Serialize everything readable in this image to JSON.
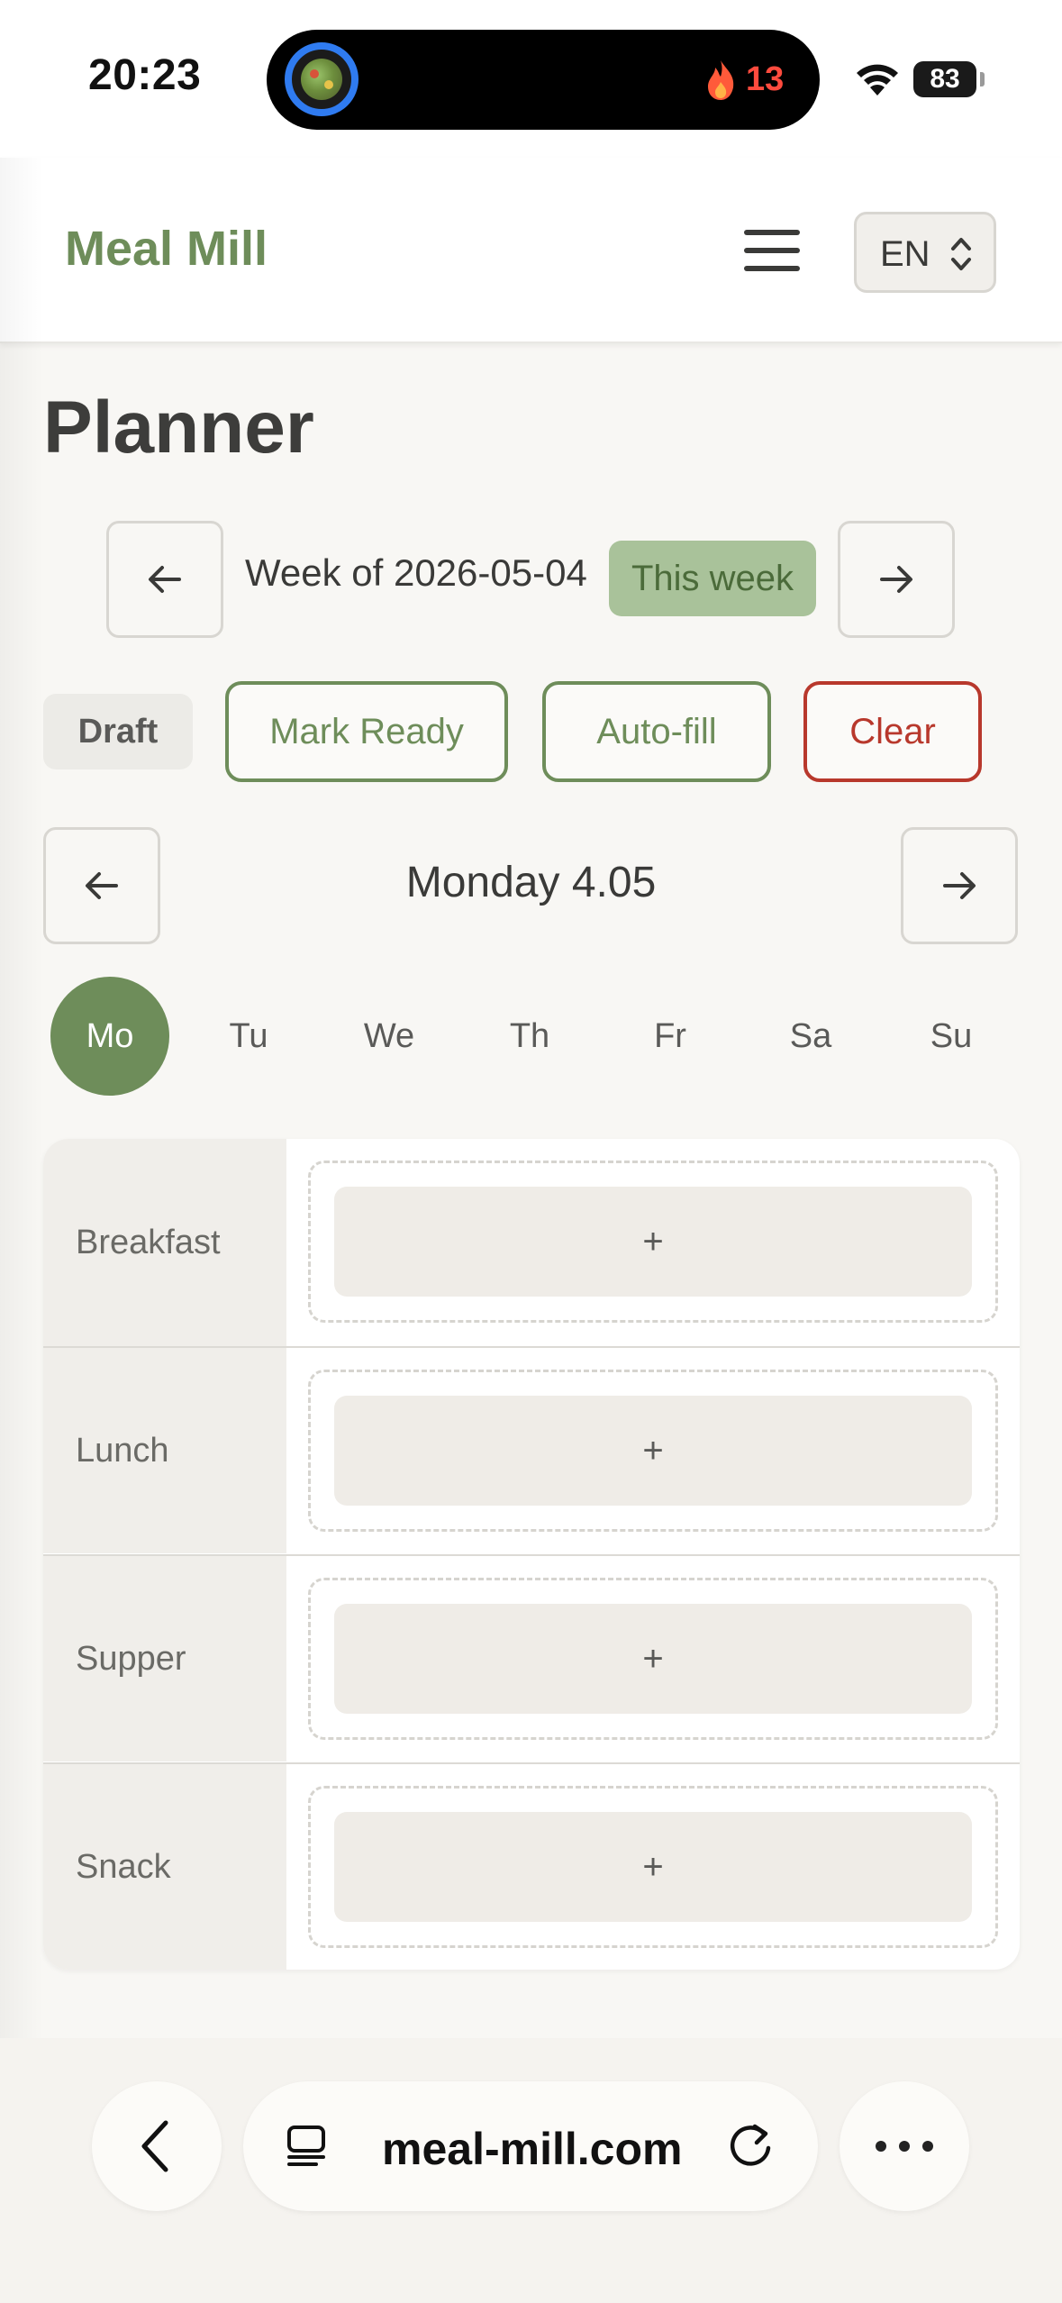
{
  "status_bar": {
    "time": "20:23",
    "streak_count": "13",
    "battery": "83",
    "icons": [
      "activity-ring-icon",
      "flame-icon",
      "wifi-icon",
      "battery-icon"
    ]
  },
  "header": {
    "brand": "Meal Mill",
    "menu_icon": "hamburger-icon",
    "language": "EN"
  },
  "planner": {
    "title": "Planner",
    "week_label": "Week of 2026-05-04",
    "this_week_label": "This week",
    "prev_week_icon": "arrow-left-icon",
    "next_week_icon": "arrow-right-icon",
    "status_badge": "Draft",
    "actions": {
      "mark_ready": "Mark Ready",
      "auto_fill": "Auto-fill",
      "clear": "Clear"
    },
    "day_title": "Monday 4.05",
    "days": [
      "Mo",
      "Tu",
      "We",
      "Th",
      "Fr",
      "Sa",
      "Su"
    ],
    "active_day": "Mo",
    "meals": [
      {
        "label": "Breakfast",
        "add": "+"
      },
      {
        "label": "Lunch",
        "add": "+"
      },
      {
        "label": "Supper",
        "add": "+"
      },
      {
        "label": "Snack",
        "add": "+"
      }
    ]
  },
  "browser": {
    "url": "meal-mill.com",
    "icons": [
      "chevron-left-icon",
      "tabs-icon",
      "reload-icon",
      "more-icon"
    ]
  },
  "colors": {
    "accent": "#6e8d5a",
    "accent_light": "#a9c29a",
    "danger": "#b8382c",
    "background": "#f8f7f4"
  }
}
